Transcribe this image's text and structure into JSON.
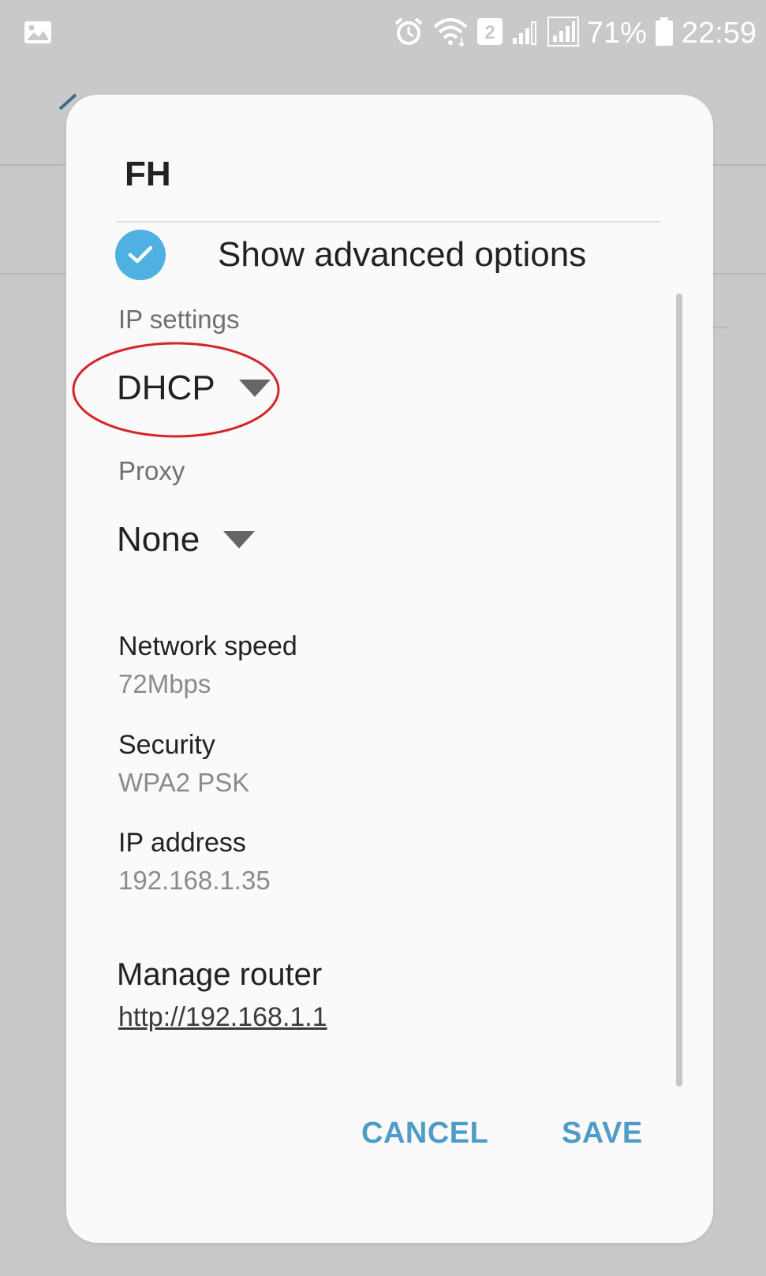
{
  "status_bar": {
    "left_icon": "image-icon",
    "icons": [
      "alarm-icon",
      "wifi-icon",
      "sim-2-icon",
      "signal-weak-icon",
      "signal-icon",
      "battery-icon"
    ],
    "sim_number": "2",
    "battery": "71%",
    "time": "22:59"
  },
  "dialog": {
    "title": "FH",
    "advanced_options": {
      "label": "Show advanced options",
      "checked": true,
      "check_color": "#4fb0e2"
    },
    "ip_settings": {
      "label": "IP settings",
      "value": "DHCP"
    },
    "proxy": {
      "label": "Proxy",
      "value": "None"
    },
    "info": [
      {
        "title": "Network speed",
        "value": "72Mbps"
      },
      {
        "title": "Security",
        "value": "WPA2 PSK"
      },
      {
        "title": "IP address",
        "value": "192.168.1.35"
      }
    ],
    "manage_router": {
      "title": "Manage router",
      "link": "http://192.168.1.1"
    },
    "buttons": {
      "cancel": "CANCEL",
      "save": "SAVE",
      "color": "#4f9cc8"
    }
  },
  "annotation": {
    "color": "#d7232b"
  }
}
